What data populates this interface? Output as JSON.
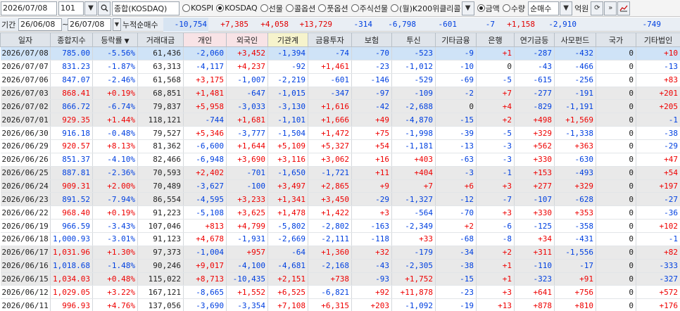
{
  "toolbar": {
    "date": "2026/07/08",
    "code": "101",
    "search_icon": "search-icon",
    "combo": "종합(KOSDAQ)",
    "radios": [
      {
        "label": "KOSPI",
        "on": false
      },
      {
        "label": "KOSDAQ",
        "on": true
      },
      {
        "label": "선물",
        "on": false
      },
      {
        "label": "콜옵션",
        "on": false
      },
      {
        "label": "풋옵션",
        "on": false
      },
      {
        "label": "주식선물",
        "on": false
      },
      {
        "label": "(월)K200위클리콜",
        "on": false
      }
    ],
    "radios2": [
      {
        "label": "금액",
        "on": true
      },
      {
        "label": "수량",
        "on": false
      }
    ],
    "mode": "순매수",
    "unit": "억원"
  },
  "sumrow": {
    "period_label": "기간",
    "from": "26/06/08",
    "tilde": "~",
    "to": "26/07/08",
    "cumulative_label": "누적순매수",
    "values": [
      "-10,754",
      "+7,385",
      "+4,058",
      "+13,729",
      "-314",
      "-6,798",
      "-601",
      "-7",
      "+1,158",
      "-2,910",
      "",
      "-749"
    ]
  },
  "headers": [
    "일자",
    "종합지수",
    "등락률",
    "거래대금",
    "개인",
    "외국인",
    "기관계",
    "금융투자",
    "보험",
    "투신",
    "기타금융",
    "은행",
    "연기금등",
    "사모펀드",
    "국가",
    "기타법인"
  ],
  "rows": [
    [
      "2026/07/08",
      "785.00",
      "-5.56%",
      "61,436",
      "-2,060",
      "+3,452",
      "-1,394",
      "-74",
      "-70",
      "-523",
      "-9",
      "+1",
      "-287",
      "-432",
      "0",
      "+10"
    ],
    [
      "2026/07/07",
      "831.23",
      "-1.87%",
      "63,313",
      "-4,117",
      "+4,237",
      "-92",
      "+1,461",
      "-23",
      "-1,012",
      "-10",
      "0",
      "-43",
      "-466",
      "0",
      "-13"
    ],
    [
      "2026/07/06",
      "847.07",
      "-2.46%",
      "61,568",
      "+3,175",
      "-1,007",
      "-2,219",
      "-601",
      "-146",
      "-529",
      "-69",
      "-5",
      "-615",
      "-256",
      "0",
      "+83"
    ],
    [
      "2026/07/03",
      "868.41",
      "+0.19%",
      "68,851",
      "+1,481",
      "-647",
      "-1,015",
      "-347",
      "-97",
      "-109",
      "-2",
      "+7",
      "-277",
      "-191",
      "0",
      "+201"
    ],
    [
      "2026/07/02",
      "866.72",
      "-6.74%",
      "79,837",
      "+5,958",
      "-3,033",
      "-3,130",
      "+1,616",
      "-42",
      "-2,688",
      "0",
      "+4",
      "-829",
      "-1,191",
      "0",
      "+205"
    ],
    [
      "2026/07/01",
      "929.35",
      "+1.44%",
      "118,121",
      "-744",
      "+1,681",
      "-1,101",
      "+1,666",
      "+49",
      "-4,870",
      "-15",
      "+2",
      "+498",
      "+1,569",
      "0",
      "-1"
    ],
    [
      "2026/06/30",
      "916.18",
      "-0.48%",
      "79,527",
      "+5,346",
      "-3,777",
      "-1,504",
      "+1,472",
      "+75",
      "-1,998",
      "-39",
      "-5",
      "+329",
      "-1,338",
      "0",
      "-38"
    ],
    [
      "2026/06/29",
      "920.57",
      "+8.13%",
      "81,362",
      "-6,600",
      "+1,644",
      "+5,109",
      "+5,327",
      "+54",
      "-1,181",
      "-13",
      "-3",
      "+562",
      "+363",
      "0",
      "-29"
    ],
    [
      "2026/06/26",
      "851.37",
      "-4.10%",
      "82,466",
      "-6,948",
      "+3,690",
      "+3,116",
      "+3,062",
      "+16",
      "+403",
      "-63",
      "-3",
      "+330",
      "-630",
      "0",
      "+47"
    ],
    [
      "2026/06/25",
      "887.81",
      "-2.36%",
      "70,593",
      "+2,402",
      "-701",
      "-1,650",
      "-1,721",
      "+11",
      "+404",
      "-3",
      "-1",
      "+153",
      "-493",
      "0",
      "+54"
    ],
    [
      "2026/06/24",
      "909.31",
      "+2.00%",
      "70,489",
      "-3,627",
      "-100",
      "+3,497",
      "+2,865",
      "+9",
      "+7",
      "+6",
      "+3",
      "+277",
      "+329",
      "0",
      "+197"
    ],
    [
      "2026/06/23",
      "891.52",
      "-7.94%",
      "86,554",
      "-4,595",
      "+3,233",
      "+1,341",
      "+3,450",
      "-29",
      "-1,327",
      "-12",
      "-7",
      "-107",
      "-628",
      "0",
      "-27"
    ],
    [
      "2026/06/22",
      "968.40",
      "+0.19%",
      "91,223",
      "-5,108",
      "+3,625",
      "+1,478",
      "+1,422",
      "+3",
      "-564",
      "-70",
      "+3",
      "+330",
      "+353",
      "0",
      "-36"
    ],
    [
      "2026/06/19",
      "966.59",
      "-3.43%",
      "107,046",
      "+813",
      "+4,799",
      "-5,802",
      "-2,802",
      "-163",
      "-2,349",
      "+2",
      "-6",
      "-125",
      "-358",
      "0",
      "+102"
    ],
    [
      "2026/06/18",
      "1,000.93",
      "-3.01%",
      "91,123",
      "+4,678",
      "-1,931",
      "-2,669",
      "-2,111",
      "-118",
      "+33",
      "-68",
      "-8",
      "+34",
      "-431",
      "0",
      "-1"
    ],
    [
      "2026/06/17",
      "1,031.96",
      "+1.30%",
      "97,373",
      "-1,004",
      "+957",
      "-64",
      "+1,360",
      "+32",
      "-179",
      "-34",
      "+2",
      "+311",
      "-1,556",
      "0",
      "+82"
    ],
    [
      "2026/06/16",
      "1,018.68",
      "-1.48%",
      "90,246",
      "+9,017",
      "-4,100",
      "-4,681",
      "-2,168",
      "-43",
      "-2,305",
      "-38",
      "+1",
      "-110",
      "-17",
      "0",
      "-333"
    ],
    [
      "2026/06/15",
      "1,034.03",
      "+0.48%",
      "115,022",
      "+8,713",
      "-10,435",
      "+2,151",
      "+738",
      "-93",
      "+1,752",
      "-15",
      "+1",
      "-323",
      "+91",
      "0",
      "-327"
    ],
    [
      "2026/06/12",
      "1,029.05",
      "+3.22%",
      "167,121",
      "-8,665",
      "+1,552",
      "+6,525",
      "-6,821",
      "+92",
      "+11,878",
      "-23",
      "+3",
      "+641",
      "+756",
      "0",
      "+572"
    ],
    [
      "2026/06/11",
      "996.93",
      "+4.76%",
      "137,056",
      "-3,690",
      "-3,354",
      "+7,108",
      "+6,315",
      "+203",
      "-1,092",
      "-19",
      "+13",
      "+878",
      "+810",
      "0",
      "+176"
    ]
  ],
  "row_shading": [
    "sel",
    "",
    "",
    "g",
    "g",
    "g",
    "",
    "",
    "",
    "g",
    "g",
    "g",
    "",
    "",
    "",
    "g",
    "g",
    "g",
    "",
    ""
  ],
  "colors": {
    "up": "#e00000",
    "down": "#0040e0",
    "selected": "#cfe3f7",
    "shaded": "#e9e9e9"
  }
}
